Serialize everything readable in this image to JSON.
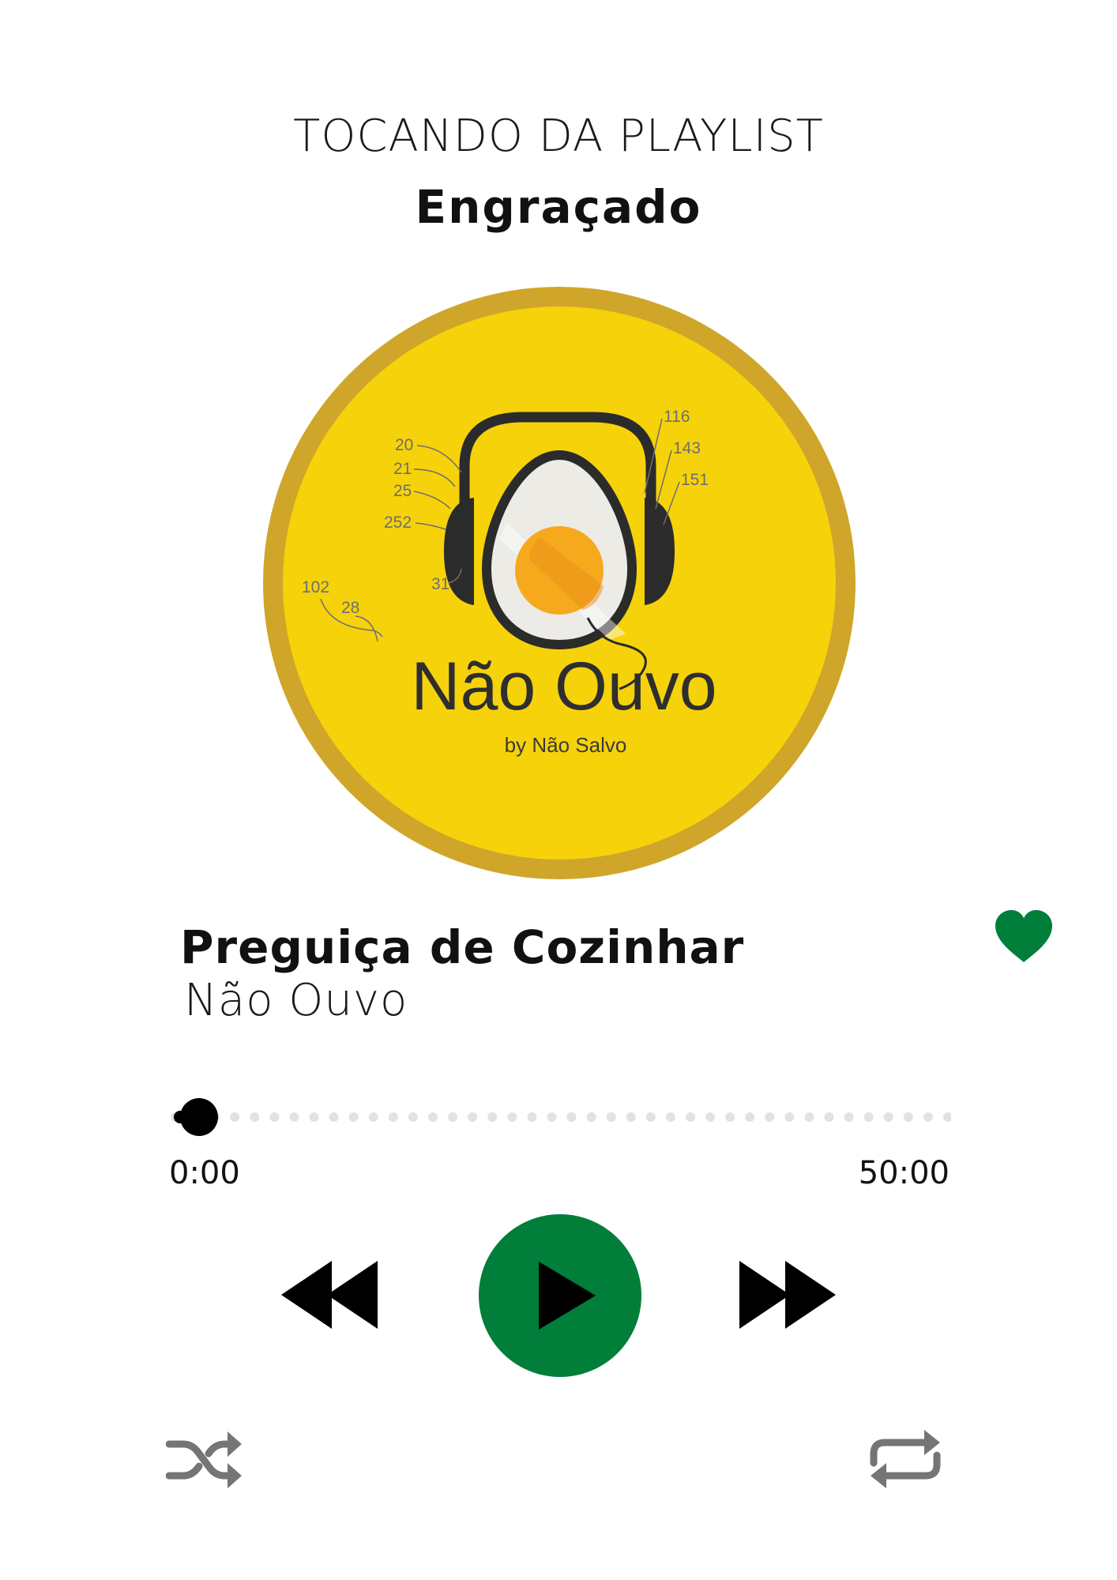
{
  "header": {
    "kicker": "TOCANDO DA PLAYLIST",
    "playlist_name": "Engraçado"
  },
  "cover": {
    "logo_title": "Não Ouvo",
    "logo_subtitle": "by Não Salvo",
    "patent_numbers": [
      "20",
      "21",
      "25",
      "252",
      "31",
      "102",
      "28",
      "116",
      "143",
      "151"
    ]
  },
  "track": {
    "title": "Preguiça de Cozinhar",
    "artist": "Não Ouvo",
    "liked": true
  },
  "progress": {
    "current_time": "0:00",
    "total_time": "50:00",
    "fraction": 0.0
  },
  "controls": {
    "rewind_icon": "rewind-icon",
    "play_icon": "play-icon",
    "forward_icon": "fast-forward-icon",
    "shuffle_icon": "shuffle-icon",
    "repeat_icon": "repeat-icon",
    "heart_icon": "heart-icon"
  },
  "colors": {
    "accent": "#007e3a",
    "cover_ring": "#cfa62a",
    "cover_fill": "#f6d20a",
    "secondary_icon": "#757575"
  }
}
